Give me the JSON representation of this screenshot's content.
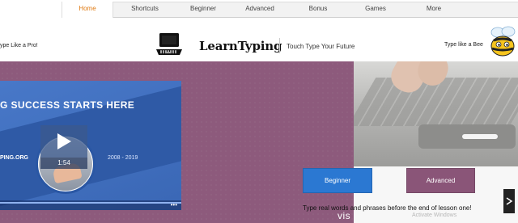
{
  "nav": {
    "items": [
      {
        "label": "Home",
        "active": true
      },
      {
        "label": "Shortcuts",
        "active": false
      },
      {
        "label": "Beginner",
        "active": false
      },
      {
        "label": "Advanced",
        "active": false
      },
      {
        "label": "Bonus",
        "active": false
      },
      {
        "label": "Games",
        "active": false
      },
      {
        "label": "More",
        "active": false
      }
    ],
    "active_color": "#e07a12"
  },
  "header": {
    "left_tagline": "ype Like a Pro!",
    "logo_text": "LearnTyping",
    "logo_subtitle": "Touch Type Your Future",
    "right_tagline": "Type like a Bee",
    "logo_icon": "laptop-icon",
    "mascot_icon": "bee-icon"
  },
  "hero": {
    "background_color": "#8d5a7c",
    "video": {
      "headline": "G SUCCESS STARTS HERE",
      "url_text": "PING.ORG",
      "years_text": "2008 - 2019",
      "duration": "1:54",
      "progress_dots": "•••",
      "accent_color": "#3a67b5"
    },
    "buttons": {
      "beginner": "Beginner",
      "advanced": "Advanced"
    },
    "button_colors": {
      "beginner": "#2b78d2",
      "advanced": "#8a5578"
    },
    "caption": "Type real words and phrases before the end of lesson one!",
    "overlay_text": "vis",
    "watermark": "Activate Windows"
  }
}
